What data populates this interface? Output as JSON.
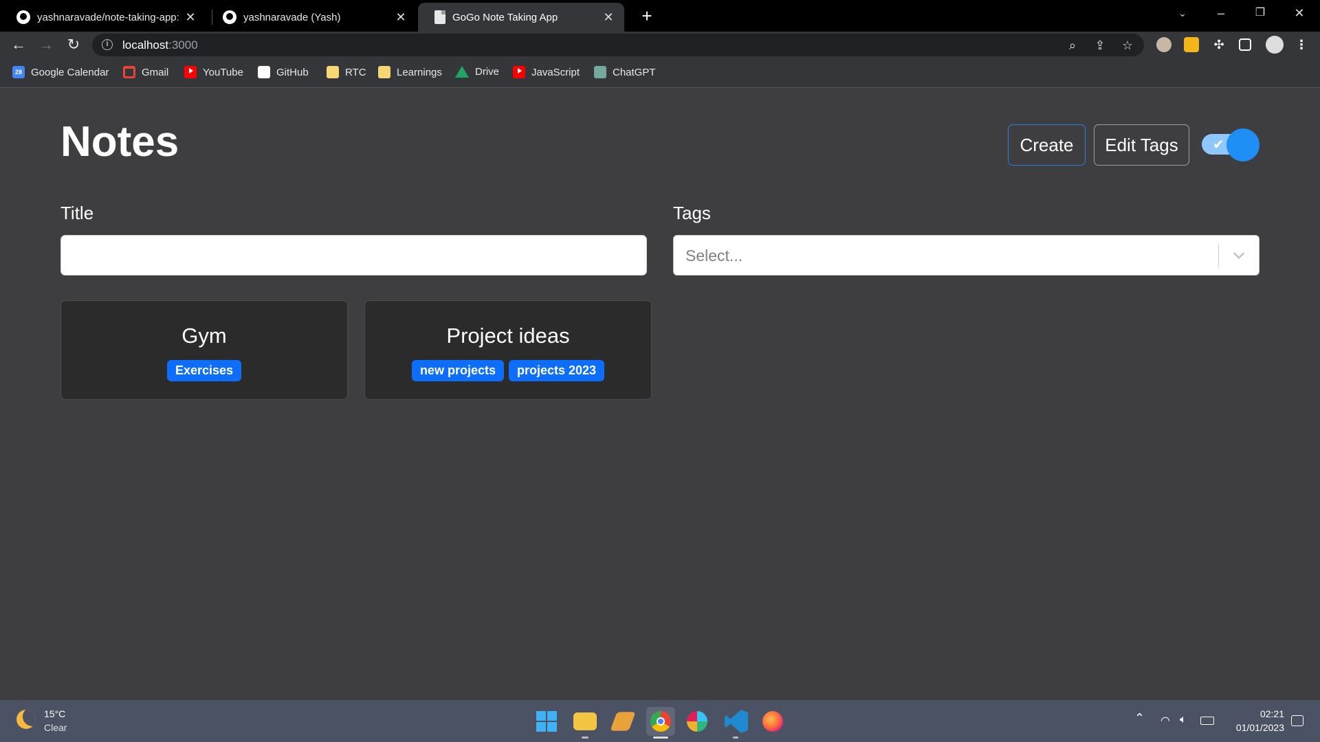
{
  "browser": {
    "tabs": [
      {
        "title": "yashnaravade/note-taking-app: N",
        "icon": "github-icon",
        "active": false
      },
      {
        "title": "yashnaravade (Yash)",
        "icon": "github-icon",
        "active": false
      },
      {
        "title": "GoGo Note Taking App",
        "icon": "document-icon",
        "active": true
      }
    ],
    "url_host": "localhost",
    "url_port": ":3000",
    "bookmarks": [
      {
        "label": "Google Calendar",
        "icon": "calendar-icon"
      },
      {
        "label": "Gmail",
        "icon": "gmail-icon"
      },
      {
        "label": "YouTube",
        "icon": "youtube-icon"
      },
      {
        "label": "GitHub",
        "icon": "github-icon"
      },
      {
        "label": "RTC",
        "icon": "folder-icon"
      },
      {
        "label": "Learnings",
        "icon": "folder-icon"
      },
      {
        "label": "Drive",
        "icon": "drive-icon"
      },
      {
        "label": "JavaScript",
        "icon": "youtube-icon"
      },
      {
        "label": "ChatGPT",
        "icon": "chatgpt-icon"
      }
    ],
    "calendar_icon_text": "28"
  },
  "page": {
    "heading": "Notes",
    "create_label": "Create",
    "edit_tags_label": "Edit Tags",
    "theme_toggle_on": true,
    "title_label": "Title",
    "title_value": "",
    "tags_label": "Tags",
    "tags_placeholder": "Select...",
    "notes": [
      {
        "title": "Gym",
        "tags": [
          "Exercises"
        ]
      },
      {
        "title": "Project ideas",
        "tags": [
          "new projects",
          "projects 2023"
        ]
      }
    ]
  },
  "taskbar": {
    "temperature": "15°C",
    "condition": "Clear",
    "time": "02:21",
    "date": "01/01/2023"
  },
  "colors": {
    "background": "#3e3e40",
    "card": "#2b2b2c",
    "badge": "#0d6efd",
    "accent": "#1f8ef5"
  }
}
